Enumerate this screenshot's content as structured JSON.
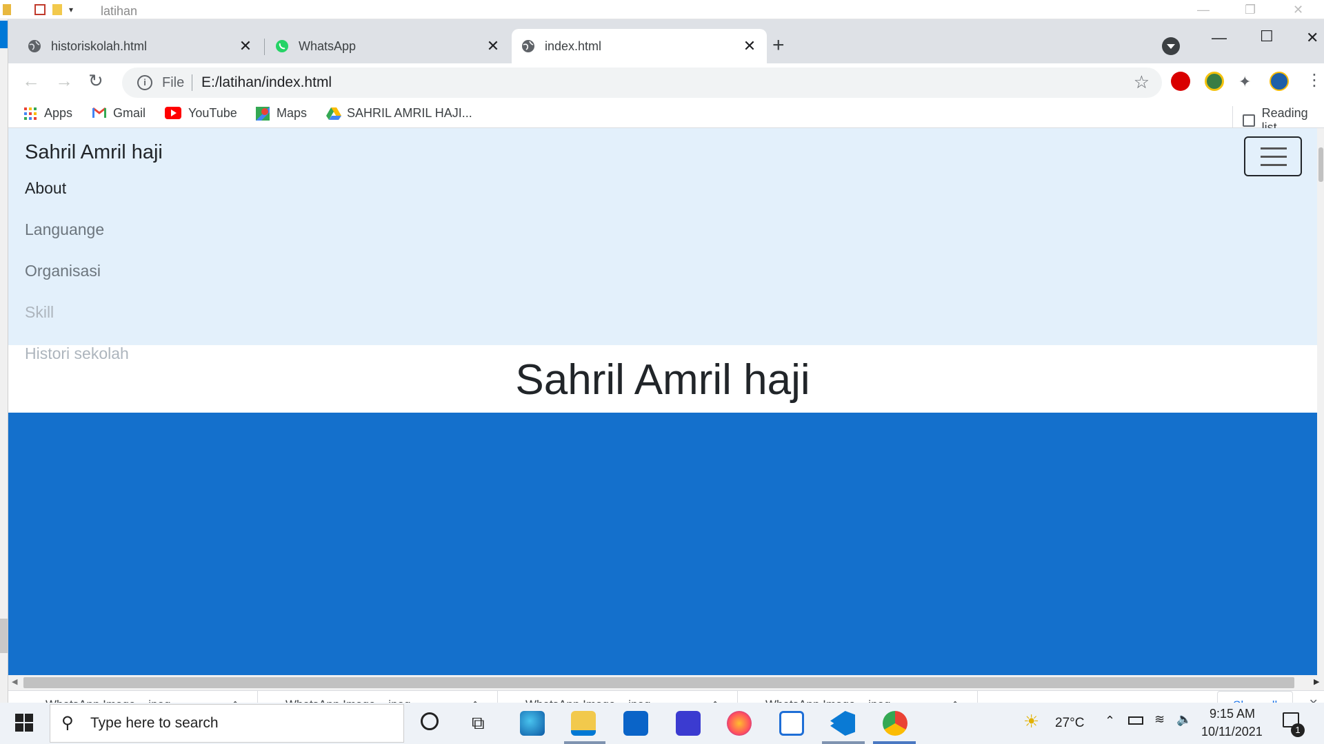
{
  "explorer": {
    "title": "latihan"
  },
  "tabs": [
    {
      "label": "historiskolah.html"
    },
    {
      "label": "WhatsApp"
    },
    {
      "label": "index.html"
    }
  ],
  "toolbar": {
    "file_label": "File",
    "url": "E:/latihan/index.html"
  },
  "bookmarks": {
    "items": [
      {
        "label": "Apps"
      },
      {
        "label": "Gmail"
      },
      {
        "label": "YouTube"
      },
      {
        "label": "Maps"
      },
      {
        "label": "SAHRIL AMRIL HAJI..."
      }
    ],
    "reading_list": "Reading list"
  },
  "page": {
    "brand": "Sahril Amril haji",
    "nav_links": [
      {
        "label": "About",
        "color": "#212529"
      },
      {
        "label": "Languange",
        "color": "#6c757d"
      },
      {
        "label": "Organisasi",
        "color": "#6c757d"
      },
      {
        "label": "Skill",
        "color": "#adb5bd"
      },
      {
        "label": "Histori sekolah",
        "color": "#adb5bd"
      }
    ],
    "hero_title": "Sahril Amril haji",
    "banner_color": "#1470cc"
  },
  "downloads": {
    "items": [
      {
        "label": "WhatsApp Image ...jpeg"
      },
      {
        "label": "WhatsApp Image ...jpeg"
      },
      {
        "label": "WhatsApp Image ...jpeg"
      },
      {
        "label": "WhatsApp Image ...jpeg"
      }
    ],
    "show_all": "Show all"
  },
  "taskbar": {
    "search_placeholder": "Type here to search",
    "weather": "27°C",
    "time": "9:15 AM",
    "date": "10/11/2021",
    "notification_count": "1"
  }
}
